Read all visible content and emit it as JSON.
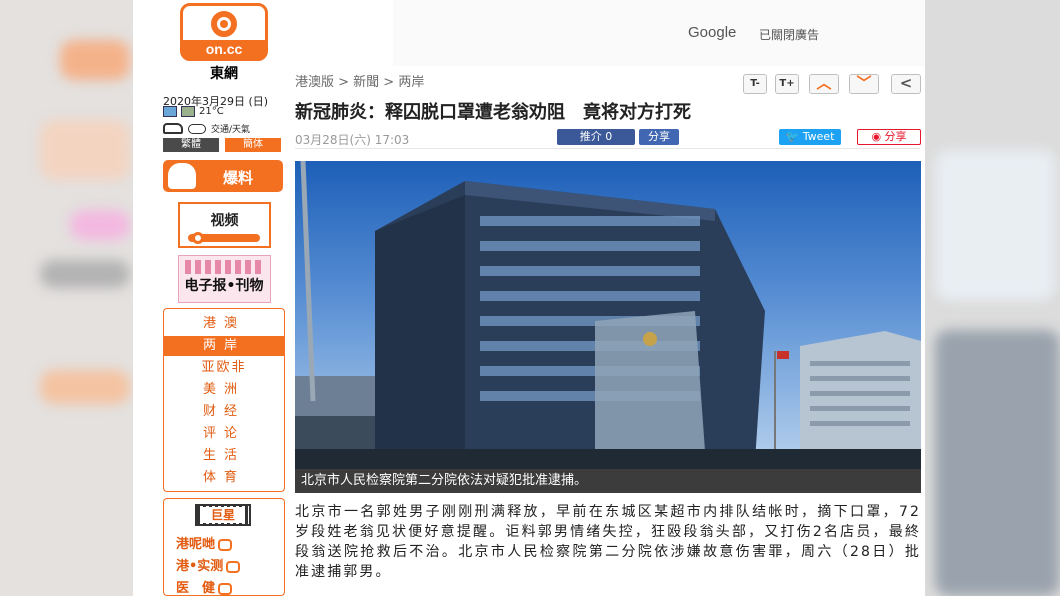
{
  "site": {
    "logo_text": "on.cc",
    "name": "東網",
    "date": "2020年3月29日 (日)",
    "temperature": "21°C",
    "traffic_weather": "交通/天氣",
    "lang_traditional": "繁體",
    "lang_simplified": "簡体"
  },
  "sidebar": {
    "baoliao": "爆料",
    "video": "视频",
    "epaper": "电子报•刊物",
    "nav": [
      {
        "label": "港澳",
        "active": false
      },
      {
        "label": "两岸",
        "active": true
      },
      {
        "label": "亚欧非",
        "active": false
      },
      {
        "label": "美洲",
        "active": false
      },
      {
        "label": "财经",
        "active": false
      },
      {
        "label": "评论",
        "active": false
      },
      {
        "label": "生活",
        "active": false
      },
      {
        "label": "体育",
        "active": false
      }
    ],
    "giant_label": "巨星",
    "giant_items": [
      "港呢哋",
      "港•实测",
      "医　健"
    ]
  },
  "ad": {
    "google": "Google",
    "note": "已關閉廣告"
  },
  "breadcrumb": "港澳版 > 新聞 > 两岸",
  "toolbar": {
    "font_smaller": "T-",
    "font_larger": "T+",
    "up": "︿",
    "down": "﹀",
    "back": "<"
  },
  "article": {
    "headline": "新冠肺炎：释囚脱口罩遭老翁劝阻　竟将对方打死",
    "time": "03月28日(六) 17:03",
    "fb_like": "推介 0",
    "fb_share": "分享",
    "tweet": "Tweet",
    "weibo": "分享",
    "caption": "北京市人民检察院第二分院依法对疑犯批准逮捕。",
    "body": "北京市一名郭姓男子刚刚刑满释放，早前在东城区某超市内排队结帐时，摘下口罩，72岁段姓老翁见状便好意提醒。讵料郭男情绪失控，狂殴段翁头部，又打伤2名店员，最終段翁送院抢救后不治。北京市人民检察院第二分院依涉嫌故意伤害罪，周六（28日）批准逮捕郭男。"
  },
  "colors": {
    "brand_orange": "#f37021",
    "caption_bg": "#3c3c3c",
    "facebook": "#3b5998",
    "twitter": "#1da1f2",
    "weibo": "#e6162d"
  }
}
